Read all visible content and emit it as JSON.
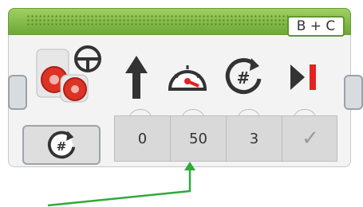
{
  "block": {
    "port_label": "B + C",
    "mode_icon": "rotations-mode-icon",
    "parameters": [
      {
        "icon": "steering-arrow-icon",
        "value": "0"
      },
      {
        "icon": "speedometer-icon",
        "value": "50"
      },
      {
        "icon": "rotations-icon",
        "value": "3"
      },
      {
        "icon": "brake-at-end-icon",
        "value": "✓"
      }
    ]
  },
  "annotation": {
    "color": "#2eaa3a"
  },
  "colors": {
    "header": "#7cbf3c",
    "brake_bar": "#e32222"
  }
}
